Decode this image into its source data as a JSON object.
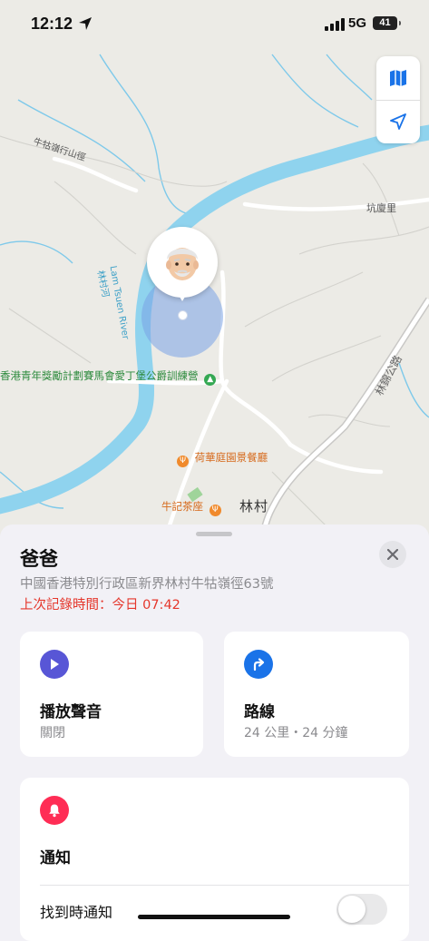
{
  "status_bar": {
    "time": "12:12",
    "network": "5G",
    "battery": "41"
  },
  "map": {
    "labels": {
      "trail": "牛牯嶺行山徑",
      "kang_ha_lei": "坑廈里",
      "river_cn": "林村河",
      "river_en": "Lam Tsuen River",
      "camp": "香港青年獎勵計劃賽馬會愛丁堡公爵訓練營",
      "restaurant": "荷華庭園景餐廳",
      "tea_house": "牛記茶座",
      "village": "林村",
      "highway": "林錦公路"
    },
    "controls": [
      "map-icon",
      "location-arrow-icon"
    ],
    "colors": {
      "river": "#8fd3ee",
      "land": "#ecebe6",
      "road": "#ffffff",
      "accuracy": "#7aa3e6"
    }
  },
  "person": {
    "name": "爸爸",
    "address": "中國香港特別行政區新界林村牛牯嶺徑63號",
    "last_seen": "上次記錄時間：今日 07:42",
    "avatar": "elderly-man-memoji"
  },
  "actions": {
    "play_sound": {
      "title": "播放聲音",
      "subtitle": "關閉",
      "icon": "play-icon",
      "color": "#5856d6"
    },
    "directions": {
      "title": "路線",
      "subtitle": "24 公里・24 分鐘",
      "icon": "turn-right-arrow-icon",
      "color": "#1a73e8"
    }
  },
  "notifications": {
    "title": "通知",
    "icon": "bell-icon",
    "color": "#ff2d55",
    "row_label": "找到時通知",
    "toggle_on": false
  },
  "accent": {
    "red": "#e5372c"
  }
}
